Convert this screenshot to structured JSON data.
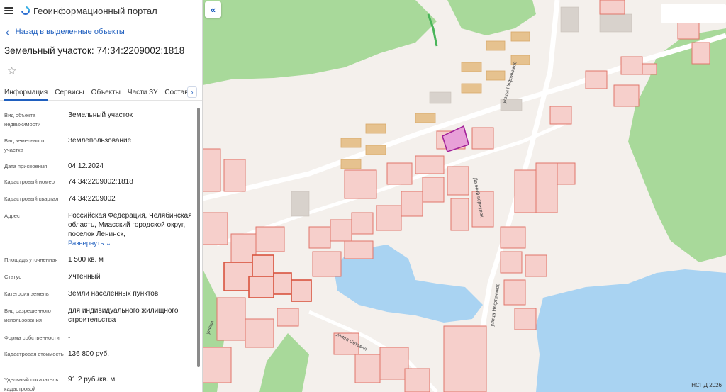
{
  "header": {
    "title": "Геоинформационный портал"
  },
  "back_link": "Назад в выделенные объекты",
  "object_title": "Земельный участок: 74:34:2209002:1818",
  "tabs": [
    "Информация",
    "Сервисы",
    "Объекты",
    "Части ЗУ",
    "Состав"
  ],
  "rows": [
    {
      "label": "Вид объекта недвижимости",
      "value": "Земельный участок"
    },
    {
      "label": "Вид земельного участка",
      "value": "Землепользование"
    },
    {
      "label": "Дата присвоения",
      "value": "04.12.2024"
    },
    {
      "label": "Кадастровый номер",
      "value": "74:34:2209002:1818"
    },
    {
      "label": "Кадастровый квартал",
      "value": "74:34:2209002"
    },
    {
      "label": "Адрес",
      "value": "Российская Федерация, Челябинская область, Миасский городской округ, поселок Ленинск,",
      "expand": "Развернуть"
    },
    {
      "label": "Площадь уточненная",
      "value": "1 500 кв. м"
    },
    {
      "label": "Статус",
      "value": "Учтенный"
    },
    {
      "label": "Категория земель",
      "value": "Земли населенных пунктов"
    },
    {
      "label": "Вид разрешенного использования",
      "value": "для индивидуального жилищного строительства"
    },
    {
      "label": "Форма собственности",
      "value": "-"
    },
    {
      "label": "Кадастровая стоимость",
      "value": "136 800 руб."
    },
    {
      "label": "Удельный показатель кадастровой",
      "value": "91,2 руб./кв. м"
    }
  ],
  "map": {
    "streets": [
      "улица Нефтяников",
      "улица Нефтяников",
      "улица Сетевая",
      "Дачный переулок",
      "улица"
    ],
    "copyright": "НСПД 2026",
    "colors": {
      "forest": "#a8d99a",
      "water": "#a9d3f2",
      "parcel_fill": "#f6cfcb",
      "parcel_stroke": "#e0756a",
      "selected_fill": "#e8a0d8",
      "selected_stroke": "#a3229a",
      "building": "#e6c28f"
    }
  },
  "icons": {
    "menu": "hamburger-icon",
    "logo": "portal-logo-icon",
    "back": "chevron-left-icon",
    "favorite": "star-icon",
    "tabs_next": "chevron-right-icon",
    "collapse": "double-chevron-left-icon"
  }
}
